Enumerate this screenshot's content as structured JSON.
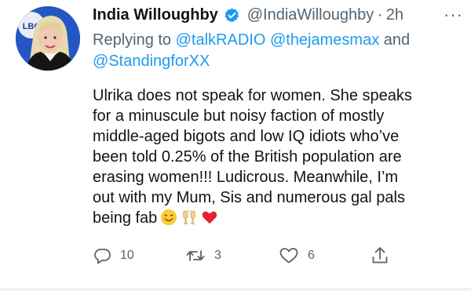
{
  "tweet": {
    "author_name": "India Willoughby",
    "handle": "@IndiaWilloughby",
    "separator": "·",
    "time": "2h",
    "more_label": "···",
    "replying": {
      "prefix": "Replying to",
      "mention_1": "@talkRADIO",
      "mention_2": "@thejamesmax",
      "conjunction": "and",
      "mention_3": "@StandingforXX"
    },
    "body_lines": [
      "Ulrika does not speak for women. She speaks",
      "for a minuscule but noisy faction of mostly",
      "middle-aged bigots and low IQ idiots who’ve",
      "been told 0.25% of the British population are",
      "erasing women!!! Ludicrous. Meanwhile, I’m",
      "out with my Mum, Sis and numerous gal pals",
      "being fab"
    ],
    "emojis": [
      "smiling-face-emoji",
      "clinking-glasses-emoji",
      "red-heart-emoji"
    ],
    "actions": {
      "reply_count": "10",
      "retweet_count": "3",
      "like_count": "6"
    },
    "icons": [
      "avatar-photo",
      "verified-badge-icon",
      "more-icon",
      "reply-icon",
      "retweet-icon",
      "like-icon",
      "share-icon"
    ],
    "colors": {
      "text": "#0f1419",
      "secondary": "#536471",
      "accent": "#1d9bf0"
    },
    "avatar_badge": "LBC"
  }
}
